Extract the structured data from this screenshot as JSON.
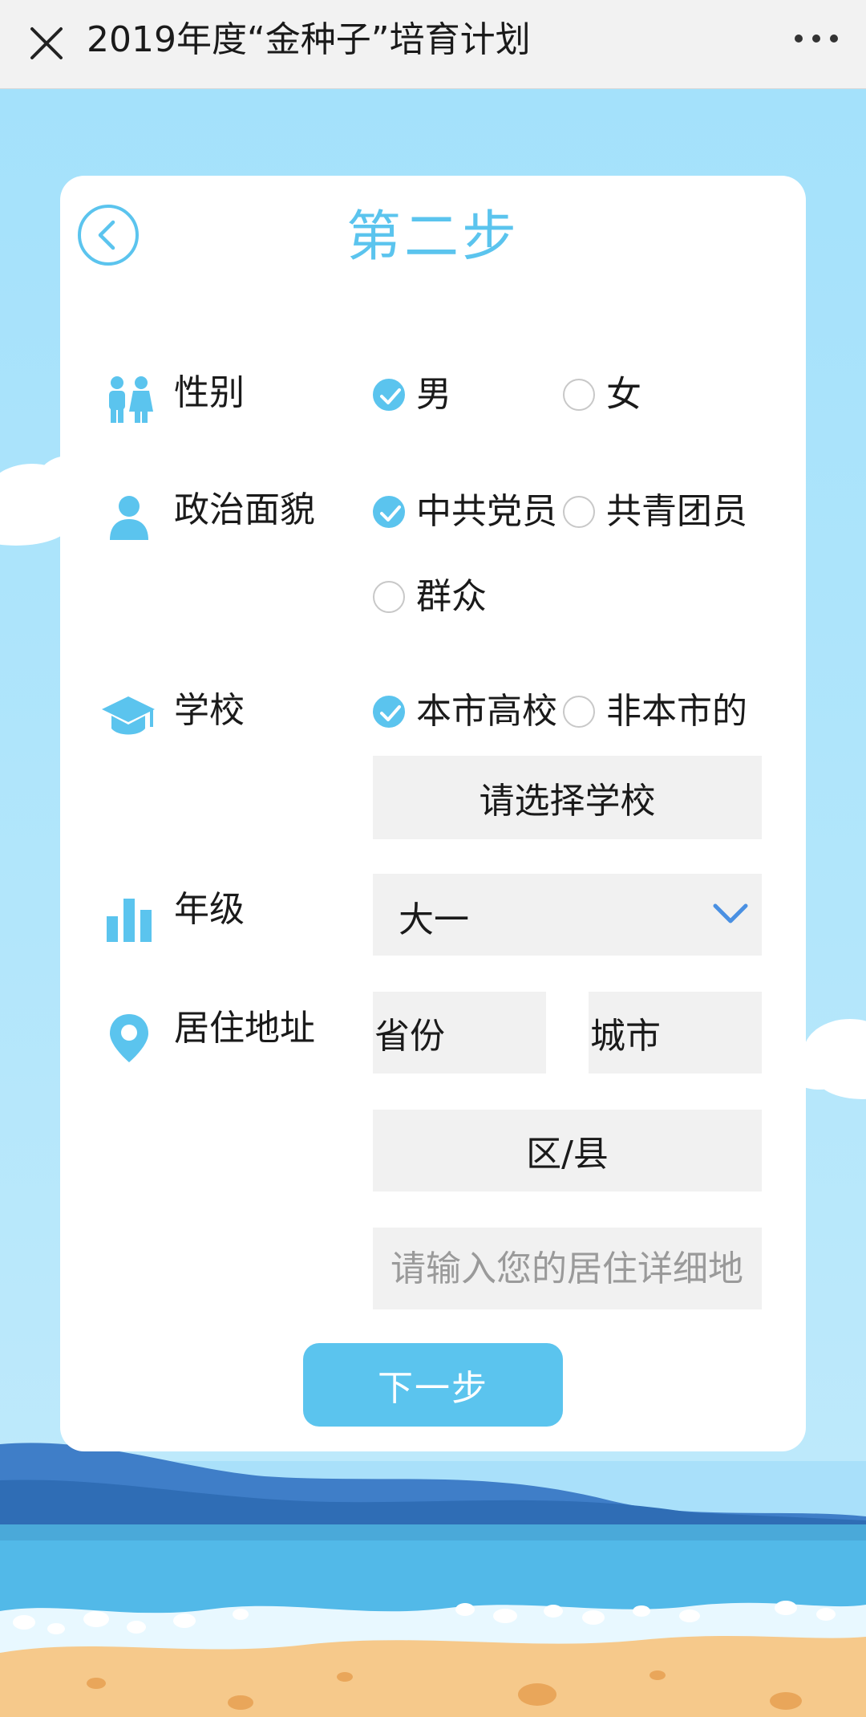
{
  "topbar": {
    "title": "2019年度“金种子”培育计划",
    "close_icon": "close-icon",
    "more_icon": "more-icon"
  },
  "card": {
    "title": "第二步",
    "back_icon": "chevron-left-circle-icon"
  },
  "form": {
    "gender": {
      "label": "性别",
      "icon": "people-icon",
      "options": [
        {
          "label": "男",
          "checked": true
        },
        {
          "label": "女",
          "checked": false
        }
      ]
    },
    "political": {
      "label": "政治面貌",
      "icon": "person-icon",
      "options": [
        {
          "label": "中共党员",
          "checked": true
        },
        {
          "label": "共青团员",
          "checked": false
        },
        {
          "label": "群众",
          "checked": false
        }
      ]
    },
    "school": {
      "label": "学校",
      "icon": "graduation-cap-icon",
      "options": [
        {
          "label": "本市高校",
          "checked": true
        },
        {
          "label": "非本市的",
          "checked": false
        }
      ],
      "select_label": "请选择学校"
    },
    "grade": {
      "label": "年级",
      "icon": "bar-chart-icon",
      "value": "大一"
    },
    "address": {
      "label": "居住地址",
      "icon": "location-pin-icon",
      "province": "省份",
      "city": "城市",
      "district": "区/县",
      "detail_value": "",
      "detail_placeholder": "请输入您的居住详细地址"
    },
    "next_label": "下一步"
  },
  "colors": {
    "accent": "#5bc4ee",
    "sky": "#a9e0fa",
    "field_bg": "#f1f1f1"
  }
}
